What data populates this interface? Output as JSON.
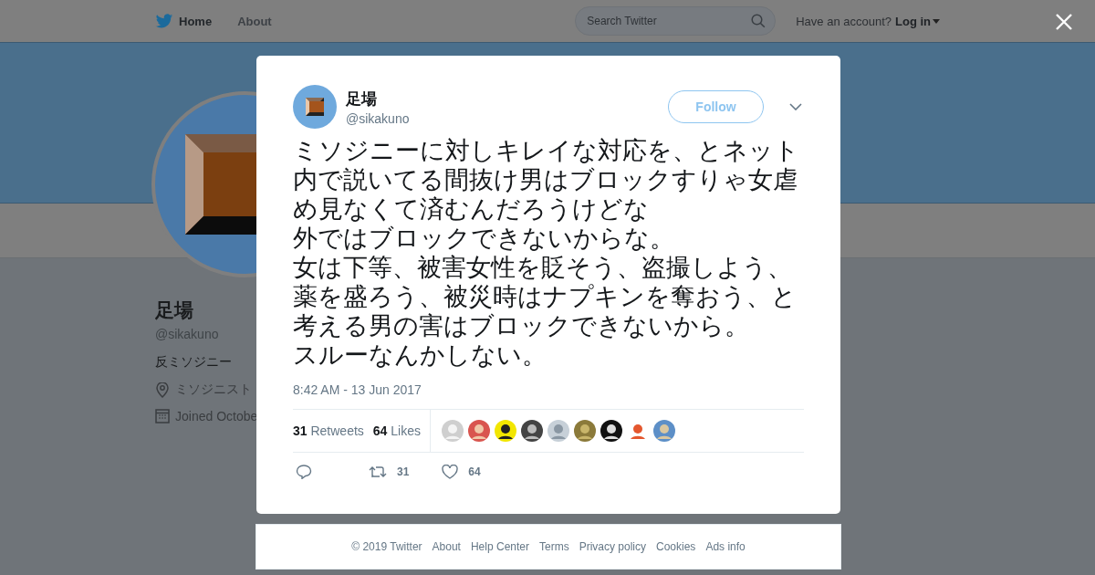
{
  "nav": {
    "items": [
      {
        "label": "Home",
        "selected": true
      },
      {
        "label": "About",
        "selected": false
      }
    ],
    "search": {
      "placeholder": "Search Twitter"
    },
    "account_prompt": "Have an account?",
    "login": "Log in"
  },
  "profile": {
    "name": "足場",
    "handle": "@sikakuno",
    "bio": "反ミソジニー",
    "location": "ミソジニスト",
    "joined": "Joined Octobe"
  },
  "tweet": {
    "name": "足場",
    "handle": "@sikakuno",
    "follow": "Follow",
    "text_paragraphs": [
      "ミソジニーに対しキレイな対応を、とネット内で説いてる間抜け男はブロックすりゃ女虐め見なくて済むんだろうけどな",
      "外ではブロックできないからな。",
      "女は下等、被害女性を貶そう、盗撮しよう、薬を盛ろう、被災時はナプキンを奪おう、と考える男の害はブロックできないから。",
      "スルーなんかしない。"
    ],
    "time": "8:42 AM - 13 Jun 2017",
    "stats": [
      {
        "count": "31",
        "label": "Retweets"
      },
      {
        "count": "64",
        "label": "Likes"
      }
    ],
    "actions": [
      {
        "kind": "reply"
      },
      {
        "kind": "retweet",
        "count": "31"
      },
      {
        "kind": "like",
        "count": "64"
      }
    ]
  },
  "footer": [
    "© 2019 Twitter",
    "About",
    "Help Center",
    "Terms",
    "Privacy policy",
    "Cookies",
    "Ads info"
  ]
}
